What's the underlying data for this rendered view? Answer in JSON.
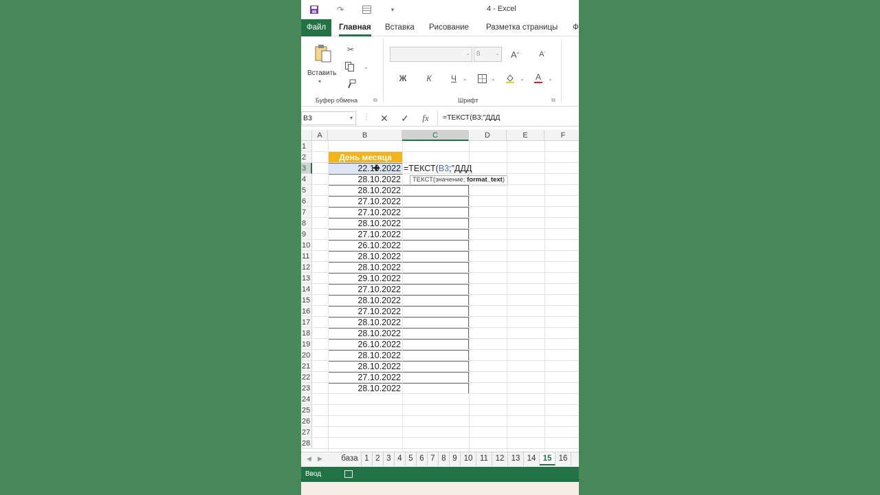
{
  "window": {
    "title": "4  -  Excel"
  },
  "quick_access": {
    "save_icon": "save-icon",
    "redo_icon": "redo-icon",
    "form_icon": "form-icon",
    "customize_icon": "customize-icon"
  },
  "tabs": [
    {
      "label": "Файл"
    },
    {
      "label": "Главная"
    },
    {
      "label": "Вставка"
    },
    {
      "label": "Рисование"
    },
    {
      "label": "Разметка страницы"
    },
    {
      "label": "Ф"
    }
  ],
  "ribbon": {
    "clipboard": {
      "paste_label": "Вставить",
      "group_label": "Буфер обмена"
    },
    "font": {
      "font_name": "",
      "font_size": "8",
      "bold": "Ж",
      "italic": "К",
      "underline": "Ч",
      "grow": "A",
      "shrink": "A",
      "font_color": "A",
      "group_label": "Шрифт"
    }
  },
  "formula_bar": {
    "name_box": "B3",
    "fx": "fx",
    "formula": "=ТЕКСТ(B3;\"ДДД"
  },
  "sheet": {
    "columns": [
      "A",
      "B",
      "C",
      "D",
      "E",
      "F"
    ],
    "rows": [
      "1",
      "2",
      "3",
      "4",
      "5",
      "6",
      "7",
      "8",
      "9",
      "10",
      "11",
      "12",
      "13",
      "14",
      "15",
      "16",
      "17",
      "18",
      "19",
      "20",
      "21",
      "22",
      "23",
      "24",
      "25",
      "26",
      "27",
      "28"
    ],
    "header_cell": "День месяца",
    "dates": [
      "22.10.2022",
      "28.10.2022",
      "28.10.2022",
      "27.10.2022",
      "27.10.2022",
      "28.10.2022",
      "27.10.2022",
      "26.10.2022",
      "28.10.2022",
      "28.10.2022",
      "29.10.2022",
      "27.10.2022",
      "28.10.2022",
      "27.10.2022",
      "28.10.2022",
      "28.10.2022",
      "26.10.2022",
      "28.10.2022",
      "28.10.2022",
      "27.10.2022",
      "28.10.2022"
    ],
    "edit": {
      "prefix": "=ТЕКСТ(",
      "ref": "B3",
      "suffix": ";\"",
      "text": "ДДД"
    },
    "tooltip": {
      "prefix": "ТЕКСТ(значение; ",
      "bold": "format_text",
      "suffix": ")"
    }
  },
  "sheet_tabs": [
    "база",
    "1",
    "2",
    "3",
    "4",
    "5",
    "6",
    "7",
    "8",
    "9",
    "10",
    "11",
    "12",
    "13",
    "14",
    "15",
    "16"
  ],
  "active_sheet": "15",
  "status": {
    "mode": "Ввод"
  },
  "colors": {
    "excel_green": "#217346",
    "header_fill": "#f2b416",
    "background": "#488858"
  }
}
